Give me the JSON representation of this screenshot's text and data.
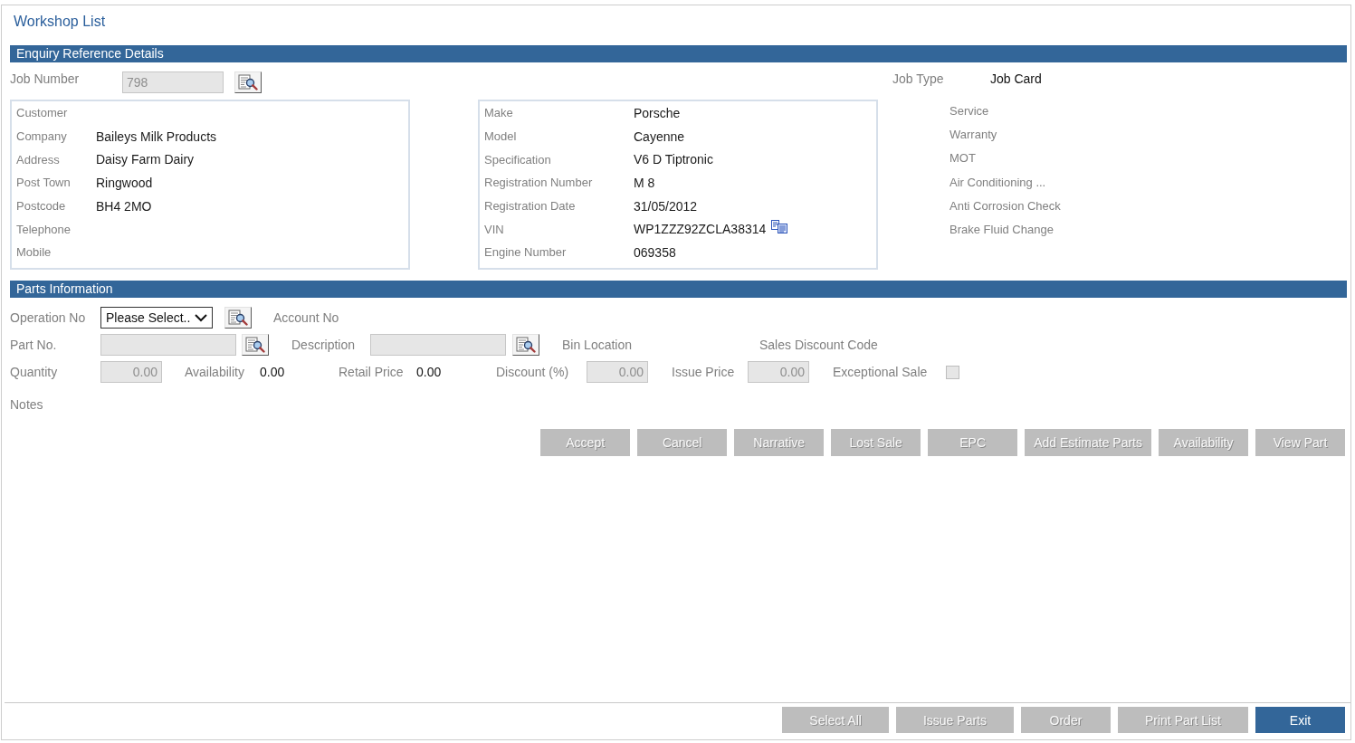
{
  "window": {
    "title": "Workshop List"
  },
  "enquiry": {
    "title": "Enquiry Reference Details",
    "job_number": {
      "label": "Job Number",
      "value": "798",
      "disabled": true
    },
    "job_type": {
      "label": "Job Type",
      "value": "Job Card"
    },
    "customer": {
      "heading": "Customer",
      "fields": [
        {
          "label": "Company",
          "value": "Baileys Milk Products"
        },
        {
          "label": "Address",
          "value": "Daisy Farm Dairy"
        },
        {
          "label": "Post Town",
          "value": "Ringwood"
        },
        {
          "label": "Postcode",
          "value": "BH4 2MO"
        },
        {
          "label": "Telephone"
        },
        {
          "label": "Mobile"
        }
      ]
    },
    "vehicle": {
      "fields": [
        {
          "label": "Make",
          "value": "Porsche",
          "kind": "text"
        },
        {
          "label": "Model",
          "value": "Cayenne",
          "kind": "text"
        },
        {
          "label": "Specification",
          "value": "V6 D Tiptronic",
          "kind": "text"
        },
        {
          "label": "Registration Number",
          "value": "M 8",
          "kind": "text"
        },
        {
          "label": "Registration Date",
          "value": "31/05/2012",
          "kind": "text"
        },
        {
          "label": "VIN",
          "value": "WP1ZZZ92ZCLA38314",
          "kind": "copyable"
        },
        {
          "label": "Engine Number",
          "value": "069358",
          "kind": "text"
        }
      ]
    },
    "job_categories": [
      "Service",
      "Warranty",
      "MOT",
      "Air Conditioning ...",
      "Anti Corrosion Check",
      "Brake Fluid Change"
    ]
  },
  "parts": {
    "title": "Parts Information",
    "rows": [
      {
        "items": [
          {
            "kind": "label",
            "text": "Operation No"
          },
          {
            "kind": "select",
            "value": "Please Select.."
          },
          {
            "kind": "lookup"
          },
          {
            "kind": "label",
            "text": "Account No"
          }
        ]
      },
      {
        "items": [
          {
            "kind": "label",
            "text": "Part No."
          },
          {
            "kind": "input",
            "disabled": true
          },
          {
            "kind": "lookup"
          },
          {
            "kind": "label",
            "text": "Description"
          },
          {
            "kind": "input",
            "disabled": true
          },
          {
            "kind": "lookup"
          },
          {
            "kind": "label",
            "text": "Bin Location"
          },
          {
            "kind": "label",
            "text": "Sales Discount Code"
          }
        ]
      },
      {
        "items": [
          {
            "kind": "label",
            "text": "Quantity"
          },
          {
            "kind": "input",
            "value": "0.00",
            "disabled": true
          },
          {
            "kind": "label",
            "text": "Availability"
          },
          {
            "kind": "value",
            "text": "0.00"
          },
          {
            "kind": "label",
            "text": "Retail Price"
          },
          {
            "kind": "value",
            "text": "0.00"
          },
          {
            "kind": "label",
            "text": "Discount (%)"
          },
          {
            "kind": "input",
            "value": "0.00",
            "disabled": true
          },
          {
            "kind": "label",
            "text": "Issue Price"
          },
          {
            "kind": "input",
            "value": "0.00",
            "disabled": true
          },
          {
            "kind": "label",
            "text": "Exceptional Sale"
          },
          {
            "kind": "checkbox",
            "checked": false,
            "disabled": true
          }
        ]
      },
      {
        "items": [
          {
            "kind": "label",
            "text": "Notes"
          }
        ]
      }
    ]
  },
  "part_actions": [
    {
      "label": "Accept",
      "disabled": true
    },
    {
      "label": "Cancel",
      "disabled": true
    },
    {
      "label": "Narrative",
      "disabled": true
    },
    {
      "label": "Lost Sale",
      "disabled": true
    },
    {
      "label": "EPC",
      "disabled": true
    },
    {
      "label": "Add Estimate Parts",
      "disabled": true
    },
    {
      "label": "Availability",
      "disabled": true
    },
    {
      "label": "View Part",
      "disabled": true
    }
  ],
  "footer_actions": [
    {
      "label": "Select All",
      "disabled": true
    },
    {
      "label": "Issue Parts",
      "disabled": true
    },
    {
      "label": "Order",
      "disabled": true
    },
    {
      "label": "Print Part List",
      "disabled": true
    },
    {
      "label": "Exit",
      "disabled": false
    }
  ]
}
